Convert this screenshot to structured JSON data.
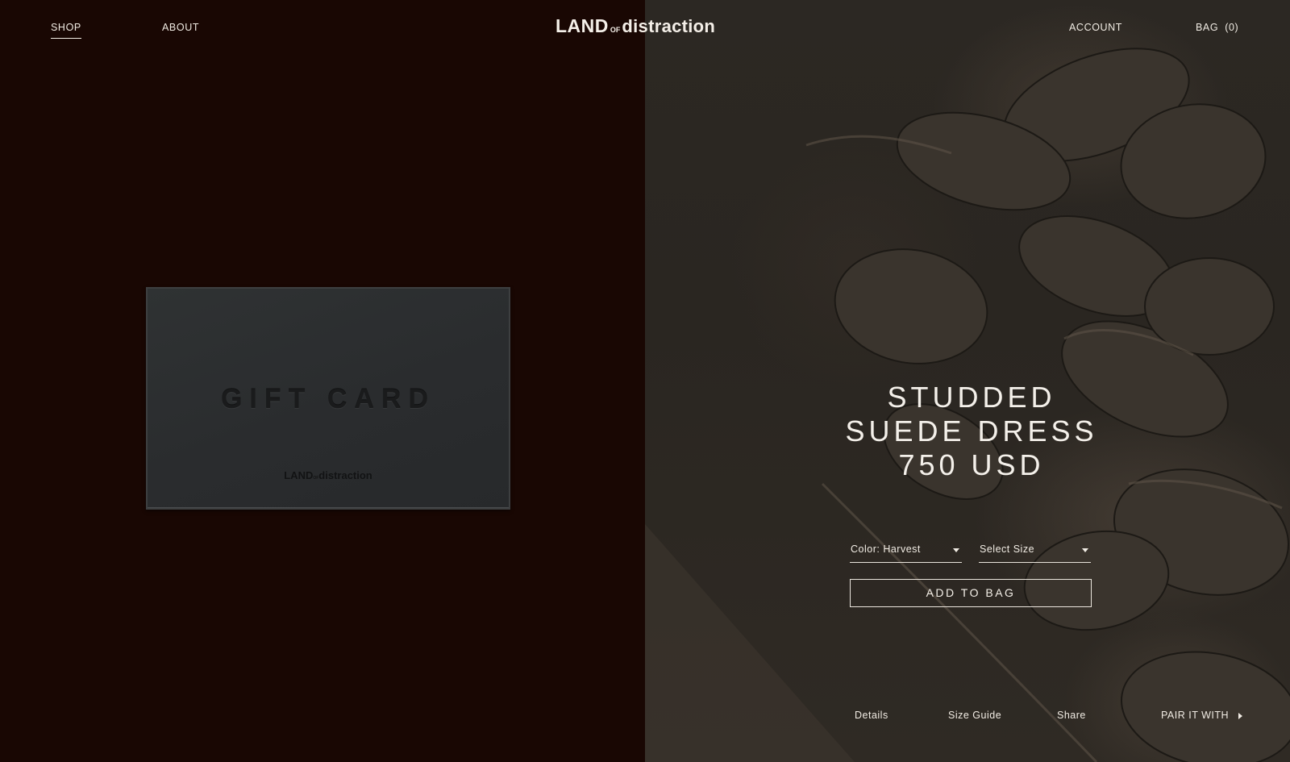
{
  "header": {
    "nav_left": [
      {
        "label": "SHOP",
        "active": true
      },
      {
        "label": "ABOUT",
        "active": false
      }
    ],
    "brand": {
      "land": "LAND",
      "of": "OF",
      "distraction": "distraction"
    },
    "account_label": "ACCOUNT",
    "bag_label": "BAG",
    "bag_count": "(0)"
  },
  "gift_card": {
    "title": "GIFT CARD",
    "logo": {
      "land": "LAND",
      "of": "OF",
      "distraction": "distraction"
    }
  },
  "product": {
    "title_lines": [
      "STUDDED",
      "SUEDE DRESS",
      "750 USD"
    ],
    "color_select": "Color: Harvest",
    "size_select": "Select Size",
    "add_to_bag": "ADD TO BAG"
  },
  "footer_links": {
    "details": "Details",
    "size_guide": "Size Guide",
    "share": "Share",
    "pair_it_with": "PAIR IT WITH"
  },
  "colors": {
    "left_background": "#190703",
    "text": "#f1ece4",
    "card": "#2c2e30"
  }
}
